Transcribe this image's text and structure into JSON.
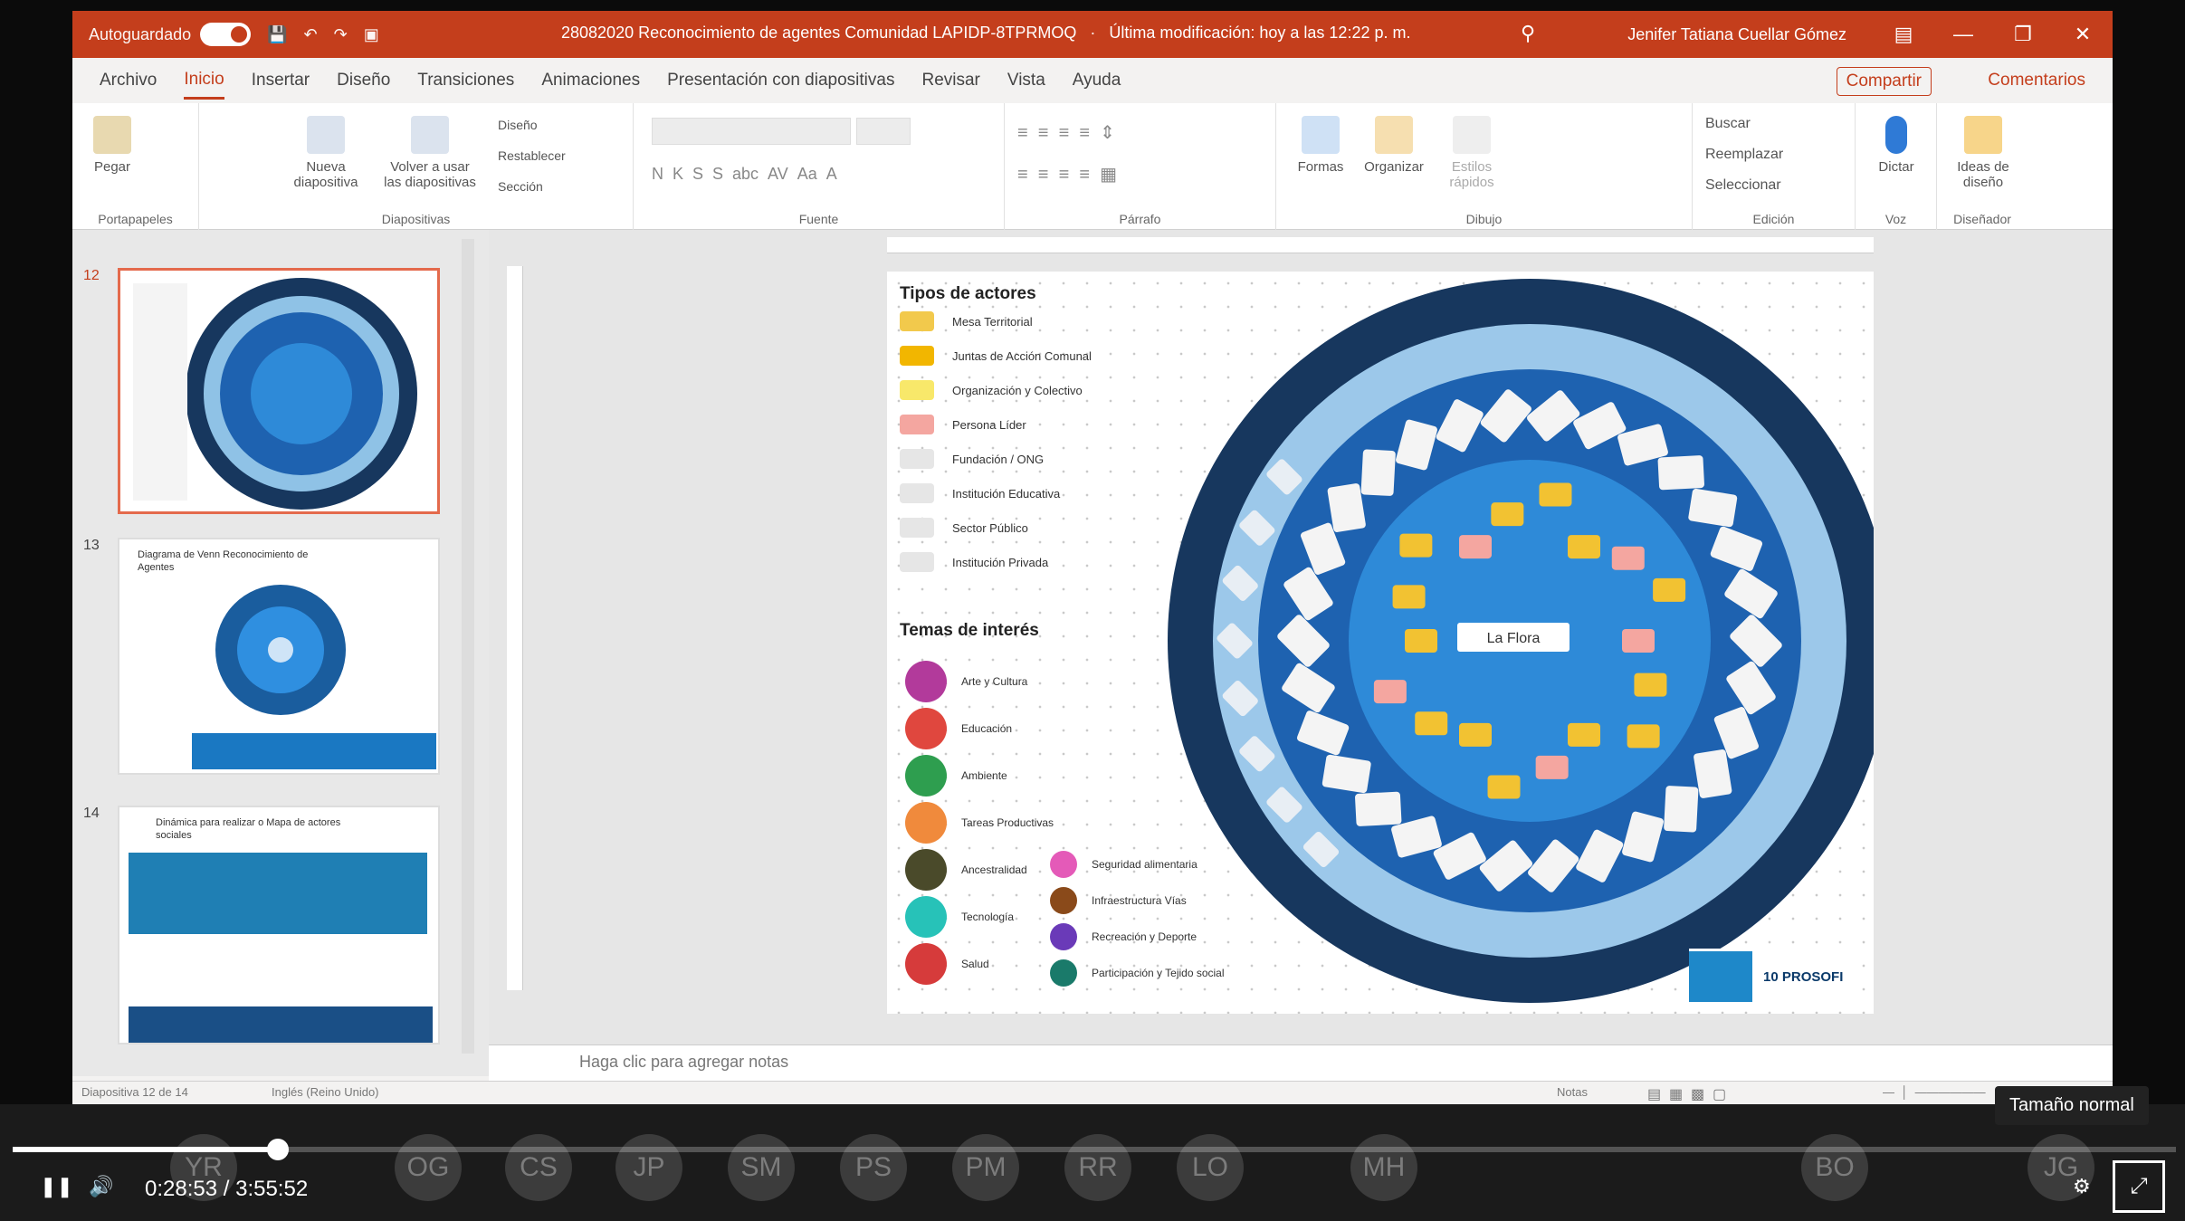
{
  "titlebar": {
    "autosave_label": "Autoguardado",
    "document_title": "28082020 Reconocimiento de agentes Comunidad LAPIDP-8TPRMOQ",
    "modified": "Última modificación: hoy a las 12:22 p. m.",
    "user": "Jenifer Tatiana Cuellar Gómez"
  },
  "menu": {
    "tabs": [
      "Archivo",
      "Inicio",
      "Insertar",
      "Diseño",
      "Transiciones",
      "Animaciones",
      "Presentación con diapositivas",
      "Revisar",
      "Vista",
      "Ayuda"
    ],
    "share": "Compartir",
    "comments": "Comentarios"
  },
  "ribbon": {
    "paste": "Pegar",
    "clipboard": "Portapapeles",
    "new_slide": "Nueva diapositiva",
    "reuse": "Volver a usar las diapositivas",
    "layout": "Diseño",
    "reset": "Restablecer",
    "section": "Sección",
    "slides_group": "Diapositivas",
    "font_group": "Fuente",
    "paragraph_group": "Párrafo",
    "shapes": "Formas",
    "arrange": "Organizar",
    "quick_styles": "Estilos rápidos",
    "drawing_group": "Dibujo",
    "find": "Buscar",
    "replace": "Reemplazar",
    "select": "Seleccionar",
    "editing_group": "Edición",
    "dictate": "Dictar",
    "voice_group": "Voz",
    "design_ideas": "Ideas de diseño",
    "designer_group": "Diseñador"
  },
  "thumbnails": [
    {
      "num": "12",
      "title": "",
      "selected": true
    },
    {
      "num": "13",
      "title": "Diagrama de Venn Reconocimiento de Agentes",
      "selected": false
    },
    {
      "num": "14",
      "title": "Dinámica para realizar o Mapa de actores sociales",
      "selected": false
    }
  ],
  "slide": {
    "actors_heading": "Tipos de actores",
    "actors": [
      {
        "label": "Mesa Territorial",
        "color": "#f2c94c"
      },
      {
        "label": "Juntas de Acción Comunal",
        "color": "#f2b600"
      },
      {
        "label": "Organización y Colectivo",
        "color": "#f8e86a"
      },
      {
        "label": "Persona Líder",
        "color": "#f4a6a0"
      },
      {
        "label": "Fundación / ONG",
        "color": "#e6e6e6"
      },
      {
        "label": "Institución Educativa",
        "color": "#e6e6e6"
      },
      {
        "label": "Sector Público",
        "color": "#e6e6e6"
      },
      {
        "label": "Institución Privada",
        "color": "#e6e6e6"
      }
    ],
    "topics_heading": "Temas de interés",
    "topics_left": [
      {
        "label": "Arte y Cultura",
        "color": "#b23a9b",
        "icon": "palette-icon"
      },
      {
        "label": "Educación",
        "color": "#e0473e",
        "icon": "book-icon"
      },
      {
        "label": "Ambiente",
        "color": "#2e9e4f",
        "icon": "leaf-icon"
      },
      {
        "label": "Tareas Productivas",
        "color": "#f08a3c",
        "icon": "tools-icon"
      },
      {
        "label": "Ancestralidad",
        "color": "#4a4a2a",
        "icon": "feather-icon"
      },
      {
        "label": "Tecnología",
        "color": "#27c2b8",
        "icon": "chip-icon"
      },
      {
        "label": "Salud",
        "color": "#d63b3b",
        "icon": "cross-icon"
      }
    ],
    "topics_right": [
      {
        "label": "Seguridad alimentaria",
        "color": "#e45ab8",
        "icon": "food-icon"
      },
      {
        "label": "Infraestructura Vías",
        "color": "#8a4a1a",
        "icon": "road-icon"
      },
      {
        "label": "Recreación y Deporte",
        "color": "#6a3ab8",
        "icon": "ball-icon"
      },
      {
        "label": "Participación y Tejido social",
        "color": "#1a7a6a",
        "icon": "people-icon"
      }
    ],
    "center_label": "La Flora",
    "logo_text": "10 PROSOFI"
  },
  "notes_placeholder": "Haga clic para agregar notas",
  "statusbar": {
    "slide_info": "Diapositiva 12 de 14",
    "language": "Inglés (Reino Unido)",
    "notes": "Notas"
  },
  "video": {
    "time_current": "0:28:53",
    "time_separator": "/",
    "time_total": "3:55:52",
    "progress": 0.1225,
    "tooltip": "Tamaño normal",
    "participants": [
      "YR",
      "OG",
      "CS",
      "JP",
      "SM",
      "PS",
      "PM",
      "RR",
      "LO",
      "MH",
      "BO",
      "JG"
    ]
  }
}
